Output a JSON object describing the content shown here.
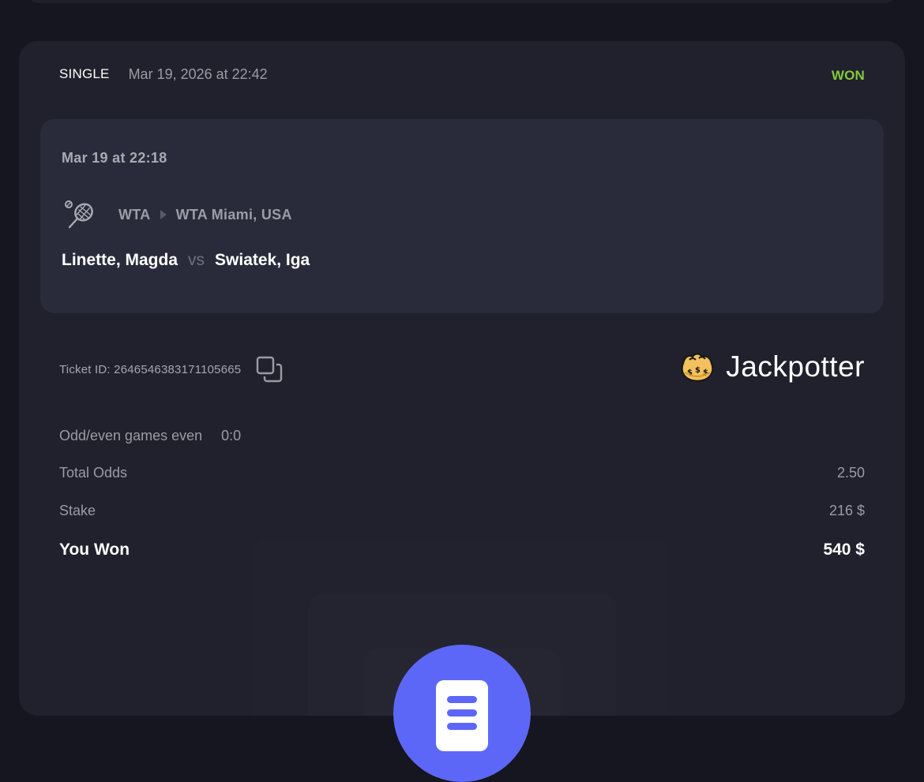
{
  "ticket": {
    "bet_type": "SINGLE",
    "placed_at": "Mar 19, 2026 at 22:42",
    "status": "WON",
    "status_color": "#83c83a"
  },
  "event": {
    "start_time": "Mar 19 at 22:18",
    "sport_icon": "tennis-racket-icon",
    "league": "WTA",
    "tournament": "WTA Miami, USA",
    "home_team": "Linette, Magda",
    "vs_label": "vs",
    "away_team": "Swiatek, Iga"
  },
  "ticket_id": {
    "label": "Ticket ID: 2646546383171105665",
    "copy_icon": "copy-icon"
  },
  "brand": {
    "name": "Jackpotter",
    "logo_icon": "jackpot-bag-icon"
  },
  "details": {
    "market_label": "Odd/even games even",
    "market_value": "0:0",
    "total_odds_label": "Total Odds",
    "total_odds_value": "2.50",
    "stake_label": "Stake",
    "stake_value": "216 $",
    "won_label": "You Won",
    "won_value": "540 $"
  },
  "fab": {
    "icon": "bet-slip-icon",
    "accent_color": "#5d67f7"
  }
}
